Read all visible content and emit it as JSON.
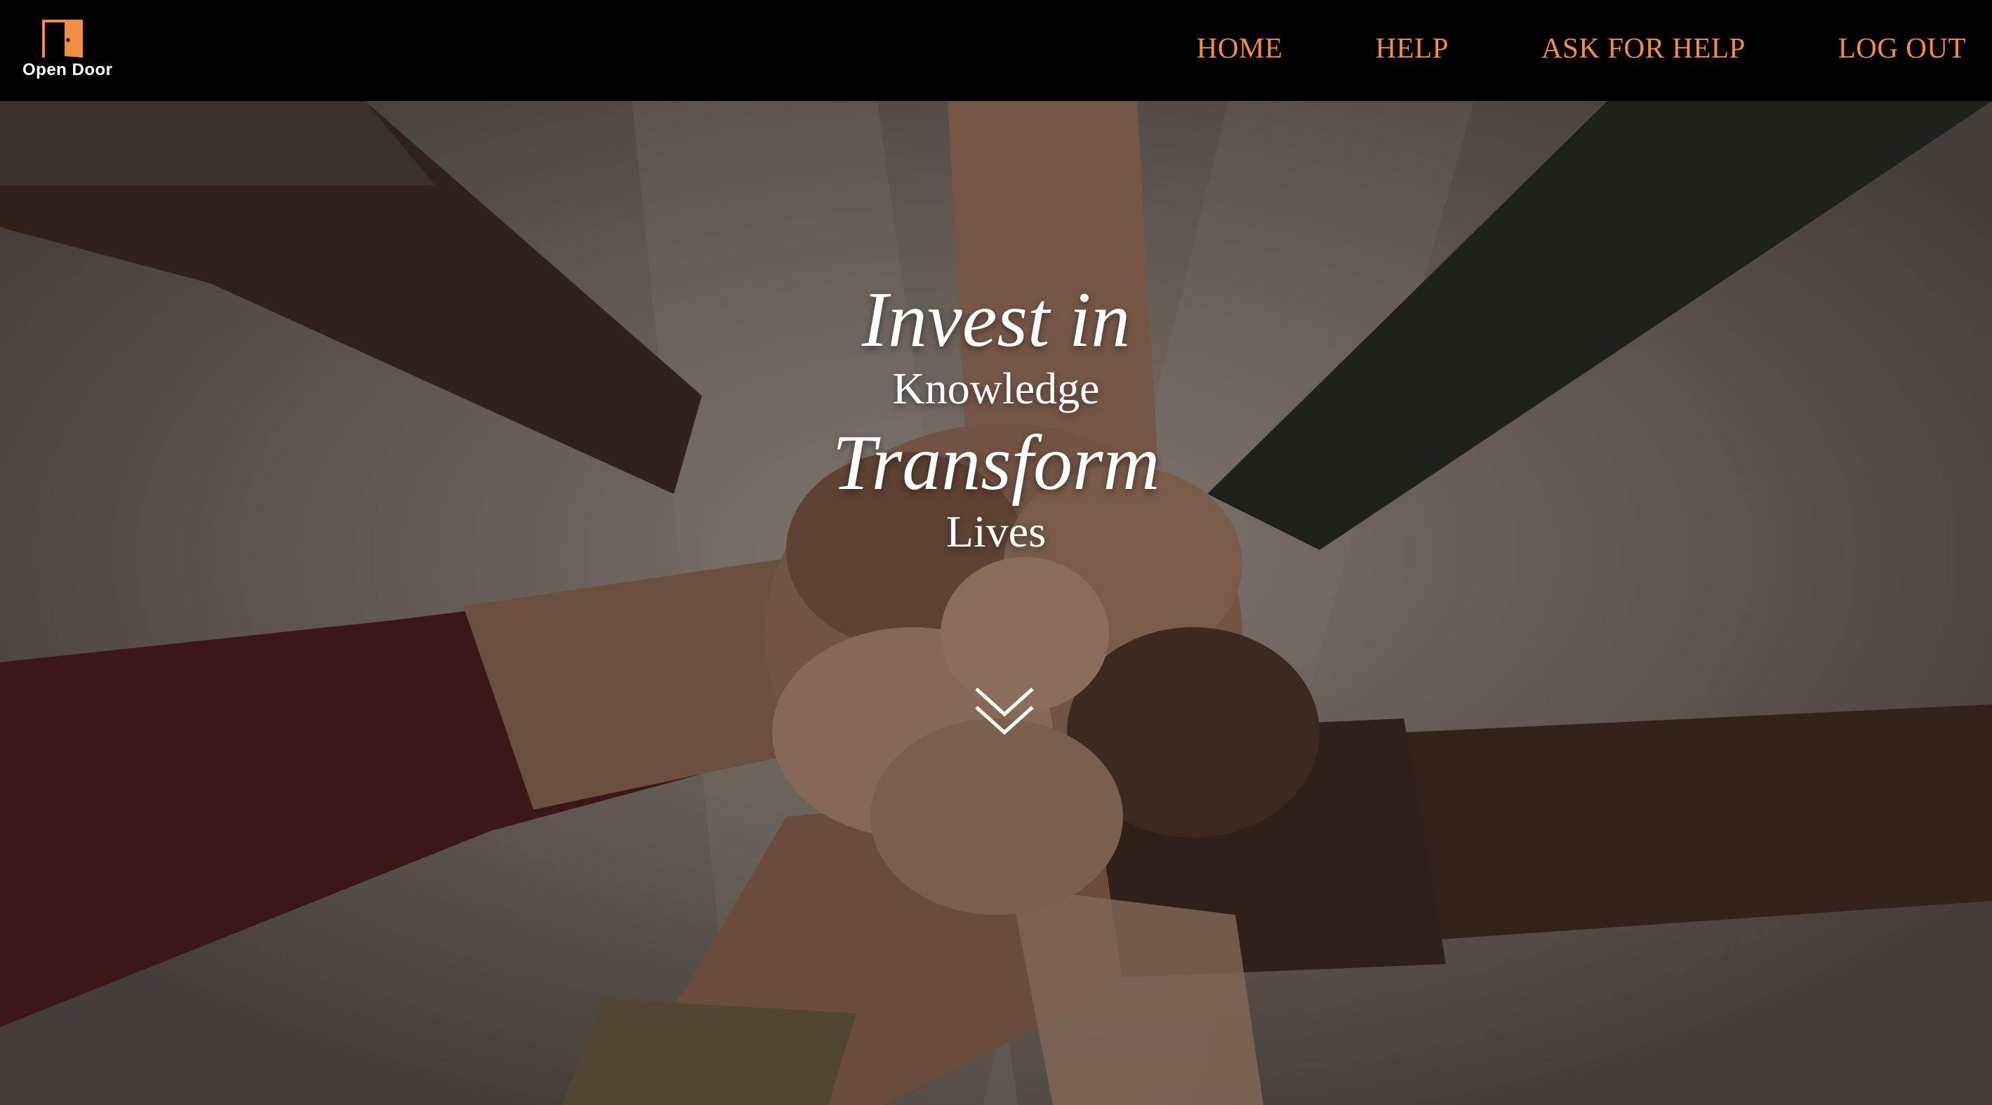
{
  "header": {
    "logo_text": "Open Door",
    "logo_icon": "open-door-icon",
    "nav": [
      {
        "label": "HOME"
      },
      {
        "label": "HELP"
      },
      {
        "label": "ASK FOR HELP"
      },
      {
        "label": "LOG OUT"
      }
    ]
  },
  "hero": {
    "background": "photo-stacked-fists",
    "line1": "Invest in",
    "line2": "Knowledge",
    "line3": "Transform",
    "line4": "Lives",
    "scroll_icon": "double-chevron-down-icon"
  },
  "colors": {
    "nav_accent": "#f08d47",
    "header_bg": "#000000",
    "tagline_text": "#ffffff"
  }
}
